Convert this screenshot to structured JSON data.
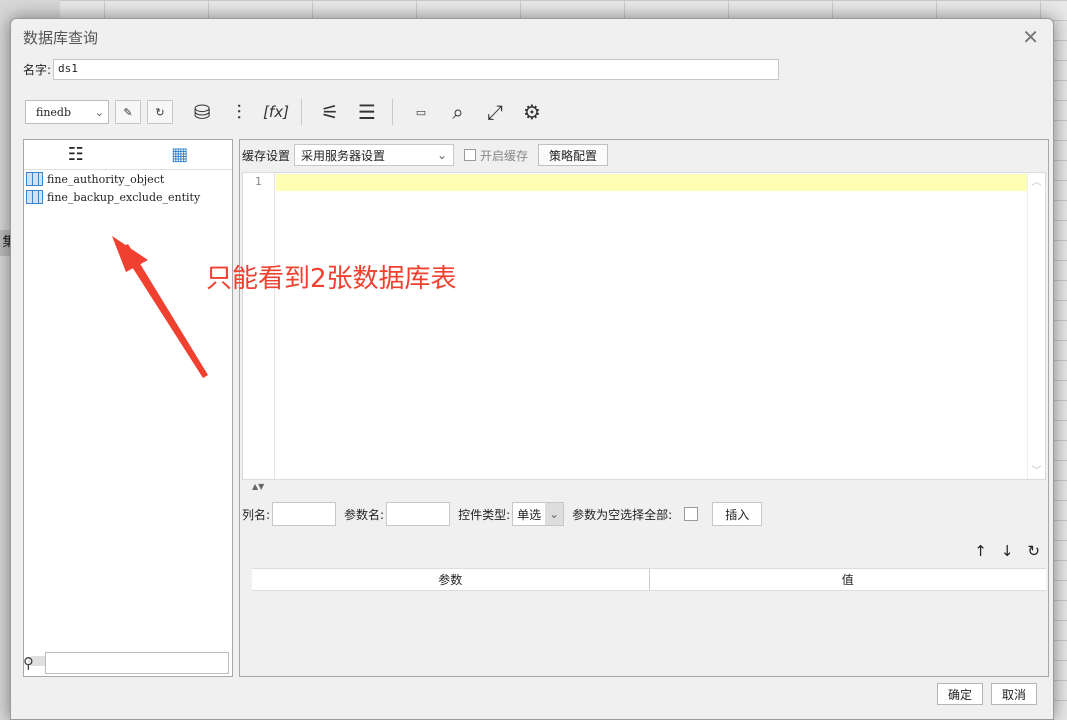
{
  "dialog": {
    "title": "数据库查询"
  },
  "name_field": {
    "label": "名字:",
    "value": "ds1"
  },
  "toolbar": {
    "db_select": "finedb",
    "icons": [
      "edit-sql-icon",
      "refresh-icon",
      "database-sql-icon",
      "sliders-icon",
      "formula-icon",
      "wand-icon",
      "split-icon",
      "sql-doc-icon",
      "preview-icon",
      "expand-icon",
      "gear-icon"
    ]
  },
  "tables": [
    {
      "name": "fine_authority_object"
    },
    {
      "name": "fine_backup_exclude_entity"
    }
  ],
  "cache": {
    "label": "缓存设置",
    "select_value": "采用服务器设置",
    "checkbox_label": "开启缓存",
    "policy_button": "策略配置"
  },
  "editor": {
    "line_number": "1"
  },
  "params": {
    "column_label": "列名:",
    "param_name_label": "参数名:",
    "control_type_label": "控件类型:",
    "control_type_value": "单选",
    "empty_select_all_label": "参数为空选择全部:",
    "insert_button": "插入",
    "table_headers": [
      "参数",
      "值"
    ]
  },
  "footer": {
    "ok": "确定",
    "cancel": "取消"
  },
  "annotation": {
    "text": "只能看到2张数据库表",
    "color": "#f04030"
  },
  "background": {
    "left_tab": "集"
  }
}
